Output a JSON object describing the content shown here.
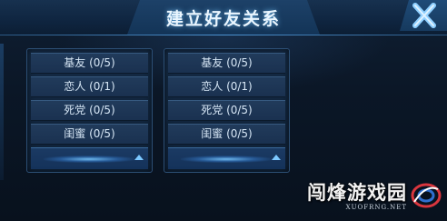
{
  "title": "建立好友关系",
  "close_icon": "close-x-icon",
  "panels": [
    {
      "rows": [
        {
          "label": "基友 (0/5)"
        },
        {
          "label": "恋人 (0/1)"
        },
        {
          "label": "死党 (0/5)"
        },
        {
          "label": "闺蜜 (0/5)"
        }
      ],
      "expand_icon": "chevron-up-icon"
    },
    {
      "rows": [
        {
          "label": "基友 (0/5)"
        },
        {
          "label": "恋人 (0/1)"
        },
        {
          "label": "死党 (0/5)"
        },
        {
          "label": "闺蜜 (0/5)"
        }
      ],
      "expand_icon": "chevron-up-icon"
    }
  ],
  "watermark": {
    "name": "闯烽游戏园",
    "domain": "XUOFRNG.NET"
  },
  "colors": {
    "accent": "#5fb4ff",
    "title_text": "#eaf6ff",
    "row_text": "#d6e6f5",
    "close_icon": "#8fd0ff"
  }
}
